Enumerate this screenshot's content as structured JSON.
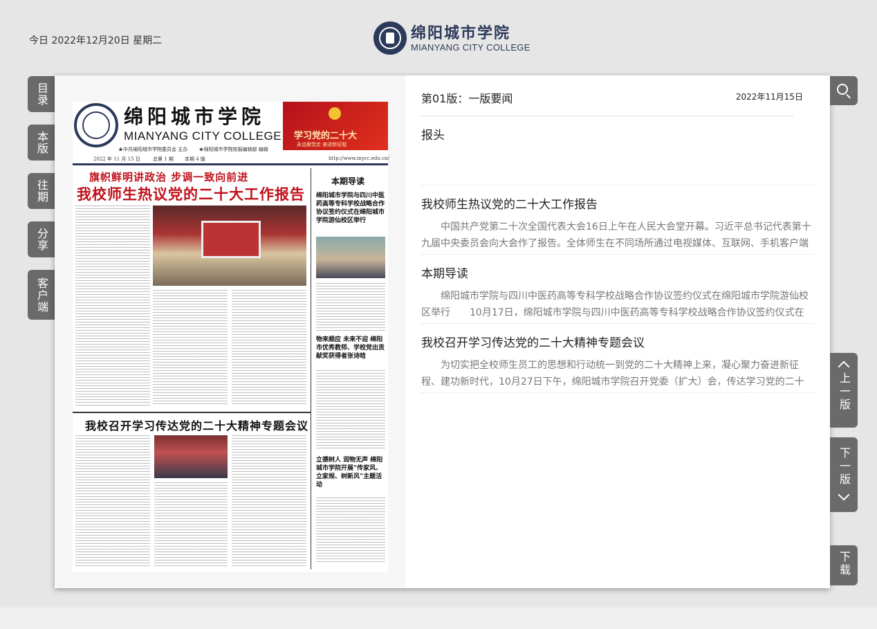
{
  "header": {
    "date_text": "今日 2022年12月20日 星期二",
    "logo_cn": "绵阳城市学院",
    "logo_en": "MIANYANG CITY COLLEGE"
  },
  "left_tabs": [
    {
      "label": "目录"
    },
    {
      "label": "本版"
    },
    {
      "label": "往期"
    },
    {
      "label": "分享"
    },
    {
      "label": "客户端"
    }
  ],
  "newspaper": {
    "masthead_cn": "绵阳城市学院",
    "masthead_en": "MIANYANG CITY COLLEGE",
    "sponsor_left": "★中共绵阳城市学院委员会 主办",
    "sponsor_right": "★绵阳城市学院校报编辑部 编辑",
    "issue_date": "2022 年 11 月 15 日",
    "issue_total": "总第 1 期",
    "issue_pages": "本期 4 版",
    "website": "http://www.mycc.edu.cn/",
    "banner_title": "学习党的二十大",
    "banner_sub": "永远跟党走  奋进新征程",
    "lead_kicker": "旗帜鲜明讲政治 步调一致向前进",
    "lead_headline": "我校师生热议党的二十大工作报告",
    "guide_title": "本期导读",
    "guide_head": "绵阳城市学院与四川中医药高等专科学校战略合作协议签约仪式在绵阳城市学院游仙校区举行",
    "side_head_2": "物来顺应 未来不迎 绵阳市优秀教师、学校党出贡献奖获得者张诗晗",
    "side_head_3": "立德树人 润物无声 绵阳城市学院开展“传家风、立家规、树新风”主题活动",
    "second_headline": "我校召开学习传达党的二十大精神专题会议"
  },
  "info": {
    "edition": "第01版：一版要闻",
    "pub_date": "2022年11月15日",
    "articles": [
      {
        "title": "报头",
        "snippet": ""
      },
      {
        "title": "我校师生热议党的二十大工作报告",
        "snippet": "中国共产党第二十次全国代表大会16日上午在人民大会堂开幕。习近平总书记代表第十九届中央委员会向大会作了报告。全体师生在不同场所通过电视媒体、互联网、手机客户端等多种渠道收听收看。"
      },
      {
        "title": "本期导读",
        "snippet": "绵阳城市学院与四川中医药高等专科学校战略合作协议签约仪式在绵阳城市学院游仙校区举行　　10月17日，绵阳城市学院与四川中医药高等专科学校战略合作协议签约仪式在绵阳城市学院游仙校区举行。"
      },
      {
        "title": "我校召开学习传达党的二十大精神专题会议",
        "snippet": "为切实把全校师生员工的思想和行动统一到党的二十大精神上来，凝心聚力奋进新征程、建功新时代，10月27日下午，绵阳城市学院召开党委（扩大）会，传达学习党的二十大精神。"
      }
    ]
  },
  "right_nav": {
    "prev_label": "上一版",
    "next_label": "下一版",
    "download_label": "下载",
    "search_icon": "search-icon"
  },
  "colors": {
    "tab_bg": "#6a6a6a",
    "brand": "#2c3a5a",
    "headline_red": "#c0101b"
  }
}
